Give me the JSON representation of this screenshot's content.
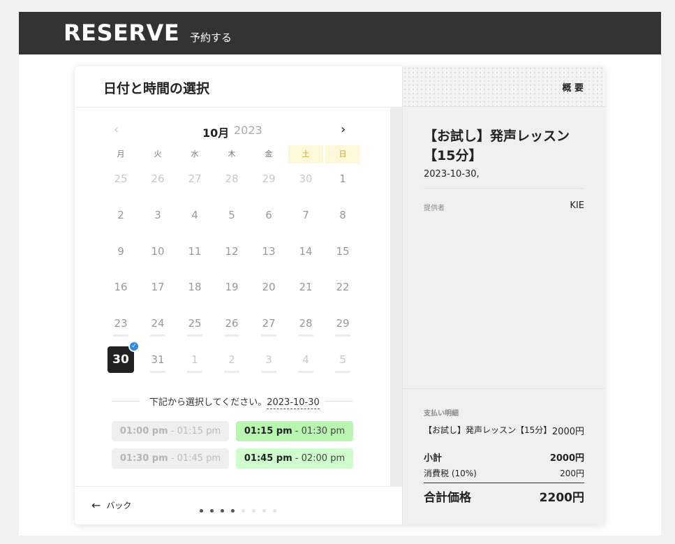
{
  "header": {
    "logo": "RESERVE",
    "nav": "予約する"
  },
  "picker": {
    "title": "日付と時間の選択",
    "month": "10月",
    "year": "2023",
    "prev_icon": "chevron-left-icon",
    "next_icon": "chevron-right-icon",
    "weekdays": [
      "月",
      "火",
      "水",
      "木",
      "金",
      "土",
      "日"
    ],
    "weeks": [
      [
        "25",
        "26",
        "27",
        "28",
        "29",
        "30",
        "1"
      ],
      [
        "2",
        "3",
        "4",
        "5",
        "6",
        "7",
        "8"
      ],
      [
        "9",
        "10",
        "11",
        "12",
        "13",
        "14",
        "15"
      ],
      [
        "16",
        "17",
        "18",
        "19",
        "20",
        "21",
        "22"
      ],
      [
        "23",
        "24",
        "25",
        "26",
        "27",
        "28",
        "29"
      ],
      [
        "30",
        "31",
        "1",
        "2",
        "3",
        "4",
        "5"
      ]
    ],
    "selected_day": "30",
    "select_prompt": "下記から選択してください。",
    "select_date": "2023-10-30",
    "slots": [
      {
        "start": "01:00 pm",
        "sep": " - ",
        "end": "01:15 pm",
        "available": false
      },
      {
        "start": "01:15 pm",
        "sep": " - ",
        "end": "01:30 pm",
        "available": true
      },
      {
        "start": "01:30 pm",
        "sep": " - ",
        "end": "01:45 pm",
        "available": false
      },
      {
        "start": "01:45 pm",
        "sep": " - ",
        "end": "02:00 pm",
        "available": true
      }
    ],
    "back_label": "バック",
    "progress_step": 4,
    "progress_total": 8
  },
  "summary": {
    "label": "概 要",
    "product_title": "【お試し】発声レッスン【15分】",
    "date": "2023-10-30,",
    "provider_label": "提供者",
    "provider_value": "KIE",
    "payment_label": "支払い明細",
    "item_name": "【お試し】発声レッスン【15分】",
    "item_price": "2000円",
    "subtotal_label": "小計",
    "subtotal_value": "2000円",
    "tax_label": "消費税 (10%)",
    "tax_value": "200円",
    "total_label": "合計価格",
    "total_value": "2200円"
  },
  "colors": {
    "topbar": "#333333",
    "available_slot": "#b8f5b0",
    "selected_day": "#222222",
    "check": "#2d89ef",
    "weekend_bg": "#fdf8da"
  }
}
